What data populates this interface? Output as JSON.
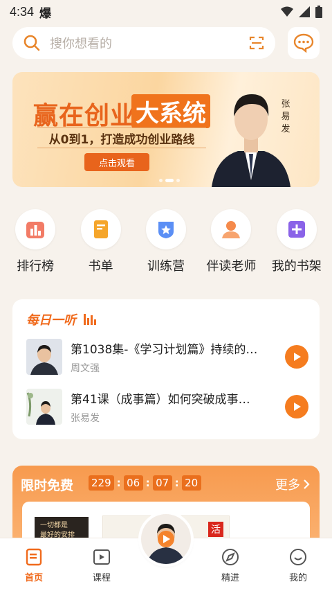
{
  "status_bar": {
    "time": "4:34",
    "notification": "爆"
  },
  "search": {
    "placeholder": "搜你想看的"
  },
  "banner": {
    "title_a": "赢在创业",
    "title_b": "大系统",
    "subtitle": "从0到1，打造成功创业路线",
    "cta": "点击观看",
    "speaker": "张易发",
    "slide_count": 3,
    "active_slide": 2
  },
  "quick_nav": [
    {
      "label": "排行榜",
      "icon": "ranking-icon",
      "color": "#f0644b"
    },
    {
      "label": "书单",
      "icon": "booklist-icon",
      "color": "#f5a52a"
    },
    {
      "label": "训练营",
      "icon": "training-camp-icon",
      "color": "#5b8ff5"
    },
    {
      "label": "伴读老师",
      "icon": "teacher-icon",
      "color": "#f58a4b"
    },
    {
      "label": "我的书架",
      "icon": "bookshelf-icon",
      "color": "#8a63e8"
    }
  ],
  "daily": {
    "title": "每日一听",
    "items": [
      {
        "title": "第1038集-《学习计划篇》持续的…",
        "author": "周文强"
      },
      {
        "title": "第41课（成事篇）如何突破成事…",
        "author": "张易发"
      }
    ]
  },
  "limited": {
    "title": "限时免费",
    "countdown": [
      "229",
      "06",
      "07",
      "20"
    ],
    "more": "更多",
    "book1_text": "一切都是\n最好的安排",
    "book2_char": "活"
  },
  "tabs": [
    {
      "label": "首页",
      "icon": "home-book-icon",
      "active": true
    },
    {
      "label": "课程",
      "icon": "course-play-icon",
      "active": false
    },
    {
      "label": "精进",
      "icon": "compass-icon",
      "active": false
    },
    {
      "label": "我的",
      "icon": "profile-smile-icon",
      "active": false
    }
  ],
  "colors": {
    "accent": "#f06a1c",
    "background": "#f7f2ec"
  }
}
